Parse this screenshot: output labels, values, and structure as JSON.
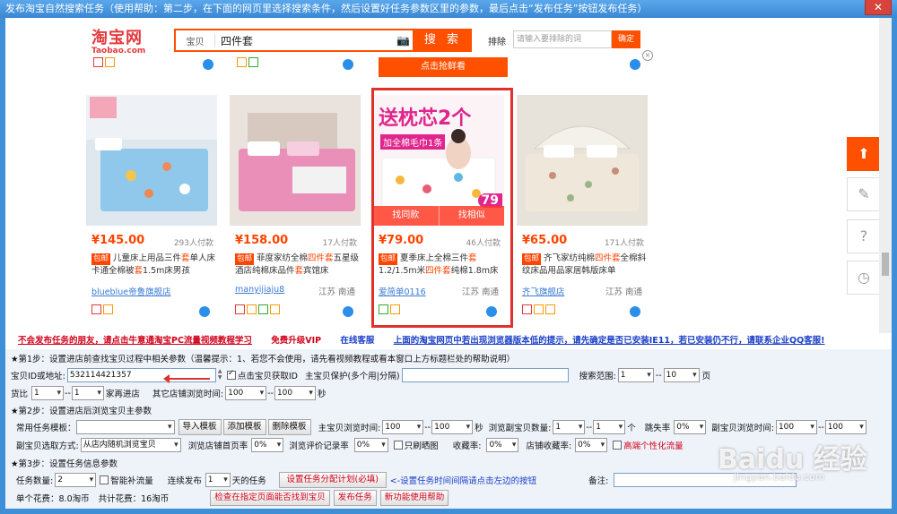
{
  "window": {
    "title": "发布淘宝自然搜索任务（使用帮助：第二步，在下面的网页里选择搜索条件，然后设置好任务参数区里的参数，最后点击“发布任务”按钮发布任务）",
    "close": "✕"
  },
  "taobao": {
    "logo_cn": "淘宝网",
    "logo_en": "Taobao.com",
    "search_category": "宝贝",
    "search_query": "四件套",
    "search_button": "搜 索",
    "exclude_label": "排除",
    "exclude_placeholder": "请输入要排除的词",
    "exclude_confirm": "确定",
    "hot_button": "点击抢鲜看",
    "ad_close": "×"
  },
  "products": [
    {
      "price": "¥145.00",
      "sales": "293人付款",
      "baoyou": "包邮",
      "desc_pre": "儿童床上用品三件",
      "desc_hl1": "套",
      "desc_mid": "单人床卡通全棉被",
      "desc_hl2": "套",
      "desc_post": "1.5m床男孩",
      "shop": "blueblue帝鲁旗舰店",
      "loc": ""
    },
    {
      "price": "¥158.00",
      "sales": "17人付款",
      "baoyou": "包邮",
      "desc_pre": "菲度家纺全棉",
      "desc_hl1": "四件套",
      "desc_mid": "五星级酒店纯棉床品件",
      "desc_hl2": "套",
      "desc_post": "宾馆床",
      "shop": "manyijiaju8",
      "loc": "江苏 南通"
    },
    {
      "price": "¥79.00",
      "sales": "46人付款",
      "baoyou": "包邮",
      "desc_pre": "夏季床上全棉三件",
      "desc_hl1": "套",
      "desc_mid": "1.2/1.5m米",
      "desc_hl2": "四件套",
      "desc_post": "纯棉1.8m床",
      "shop": "爱简单0116",
      "loc": "江苏 南通",
      "banner": "送枕芯2个",
      "banner_sub": "加全棉毛巾1条",
      "promo": "79",
      "hover_left": "找同款",
      "hover_right": "找相似"
    },
    {
      "price": "¥65.00",
      "sales": "171人付款",
      "baoyou": "包邮",
      "desc_pre": "齐飞家纺纯棉",
      "desc_hl1": "四件套",
      "desc_mid": "全棉斜纹床品用品家居韩版床单",
      "desc_hl2": "",
      "desc_post": "",
      "shop": "齐飞旗舰店",
      "loc": "江苏 南通"
    }
  ],
  "side_tools": {
    "top": "⬆",
    "edit": "✎",
    "help": "?",
    "history": "◷"
  },
  "notice": {
    "n1": "不会发布任务的朋友，请点击牛意通淘宝PC流量视频教程学习",
    "n2": "免费升级VIP",
    "n3": "在线客服",
    "n4": "上面的淘宝网页中若出现浏览器版本低的提示，请先确定是否已安装IE11，若已安装仍不行，请联系企业QQ客服!"
  },
  "step1": {
    "title": "★第1步：设置进店前查找宝贝过程中相关参数（温馨提示：1、若您不会使用，请先看视频教程或看本窗口上方标题栏处的帮助说明）",
    "id_label": "宝贝ID或地址:",
    "id_value": "532114421357",
    "fetch_id_label": "点击宝贝获取ID",
    "protect_label": "主宝贝保护(多个用|分隔)",
    "range_label": "搜索范围:",
    "range_from": "1",
    "range_to": "10",
    "range_unit": "页",
    "compare_label": "货比",
    "compare_from": "1",
    "compare_to": "1",
    "compare_suffix": "家再进店",
    "other_label": "其它店铺浏览时间:",
    "other_from": "100",
    "other_to": "100",
    "sec": "秒"
  },
  "step2": {
    "title": "★第2步：设置进店后浏览宝贝主参数",
    "template_label": "常用任务模板：",
    "import": "导入模板",
    "add": "添加模板",
    "delete": "删除模板",
    "main_time_label": "主宝贝浏览时间:",
    "main_from": "100",
    "main_to": "100",
    "sec": "秒",
    "sub_count_label": "浏览副宝贝数量:",
    "sub_from": "1",
    "sub_to": "1",
    "unit_ge": "个",
    "bounce_label": "跳失率",
    "bounce_val": "0%",
    "sub_time_label": "副宝贝浏览时间:",
    "subt_from": "100",
    "subt_to": "100",
    "select_mode_label": "副宝贝选取方式:",
    "select_mode": "从店内随机浏览宝贝",
    "home_label": "浏览店铺首页率",
    "home_val": "0%",
    "review_label": "浏览评价记录率",
    "review_val": "0%",
    "only_images": "只刷晒图",
    "fav_label": "收藏率:",
    "fav_val": "0%",
    "shop_fav_label": "店铺收藏率:",
    "shop_fav_val": "0%",
    "personal": "高端个性化流量"
  },
  "step3": {
    "title": "★第3步：设置任务信息参数",
    "count_label": "任务数量:",
    "count_val": "2",
    "smart": "智能补流量",
    "continuous_label": "连续发布",
    "continuous_val": "1",
    "continuous_suffix": "天的任务",
    "plan_button": "设置任务分配计划(必填)",
    "plan_hint": "<-设置任务时间间隔请点击左边的按钮",
    "remark_label": "备注:",
    "single_cost": "单个花费：8.0淘币",
    "total_cost": "共计花费：16淘币",
    "check_button": "检查在指定页面能否找到宝贝",
    "publish_button": "发布任务",
    "newfeature_button": "新功能使用帮助"
  },
  "watermark": {
    "brand": "Baidu 经验",
    "sub": "jingyan.baidu.com"
  }
}
